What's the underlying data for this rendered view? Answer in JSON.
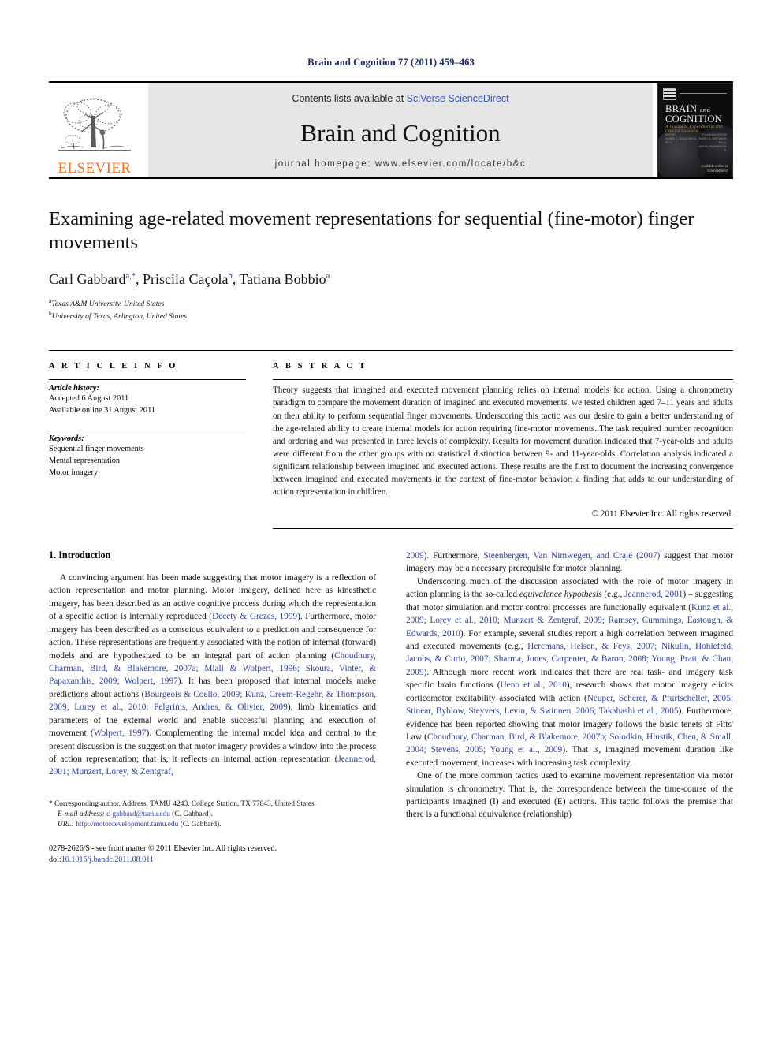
{
  "running_head": "Brain and Cognition 77 (2011) 459–463",
  "masthead": {
    "publisher": "ELSEVIER",
    "contents_prefix": "Contents lists available at ",
    "contents_link": "SciVerse ScienceDirect",
    "journal_title": "Brain and Cognition",
    "homepage": "journal homepage: www.elsevier.com/locate/b&c",
    "cover": {
      "line1": "BRAIN",
      "line1_small": "and",
      "line2": "COGNITION",
      "subtitle": "A Journal of Experimental and Clinical Research",
      "col_left": "EDITOR\nSIDNEY J. SEGALOWITZ, PH. D.",
      "col_right": "FOUNDING EDITOR\nHARRY A. WHITAKER, PH. D.\nMICHEL PARADIS, PH. D.",
      "logo_text": "Available online at\nScienceDirect"
    }
  },
  "article": {
    "title": "Examining age-related movement representations for sequential (fine-motor) finger movements",
    "authors": [
      {
        "name": "Carl Gabbard",
        "sup": "a,*"
      },
      {
        "name": "Priscila Caçola",
        "sup": "b"
      },
      {
        "name": "Tatiana Bobbio",
        "sup": "a"
      }
    ],
    "affiliations": [
      {
        "sup": "a",
        "text": "Texas A&M University, United States"
      },
      {
        "sup": "b",
        "text": "University of Texas, Arlington, United States"
      }
    ]
  },
  "article_info": {
    "heading": "A R T I C L E   I N F O",
    "history_label": "Article history:",
    "history": [
      "Accepted 6 August 2011",
      "Available online 31 August 2011"
    ],
    "keywords_label": "Keywords:",
    "keywords": [
      "Sequential finger movements",
      "Mental representation",
      "Motor imagery"
    ]
  },
  "abstract": {
    "heading": "A B S T R A C T",
    "text": "Theory suggests that imagined and executed movement planning relies on internal models for action. Using a chronometry paradigm to compare the movement duration of imagined and executed movements, we tested children aged 7–11 years and adults on their ability to perform sequential finger movements. Underscoring this tactic was our desire to gain a better understanding of the age-related ability to create internal models for action requiring fine-motor movements. The task required number recognition and ordering and was presented in three levels of complexity. Results for movement duration indicated that 7-year-olds and adults were different from the other groups with no statistical distinction between 9- and 11-year-olds. Correlation analysis indicated a significant relationship between imagined and executed actions. These results are the first to document the increasing convergence between imagined and executed movements in the context of fine-motor behavior; a finding that adds to our understanding of action representation in children.",
    "copyright": "© 2011 Elsevier Inc. All rights reserved."
  },
  "body": {
    "section_title": "1. Introduction",
    "left_paragraph_1_a": "A convincing argument has been made suggesting that motor imagery is a reflection of action representation and motor planning. Motor imagery, defined here as kinesthetic imagery, has been described as an active cognitive process during which the representation of a specific action is internally reproduced (",
    "left_cite_1": "Decety & Grezes, 1999",
    "left_paragraph_1_b": "). Furthermore, motor imagery has been described as a conscious equivalent to a prediction and consequence for action. These representations are frequently associated with the notion of internal (forward) models and are hypothesized to be an integral part of action planning (",
    "left_cite_2": "Choudhury, Charman, Bird, & Blakemore, 2007a; Miall & Wolpert, 1996; Skoura, Vinter, & Papaxanthis, 2009; Wolpert, 1997",
    "left_paragraph_1_c": "). It has been proposed that internal models make predictions about actions (",
    "left_cite_3": "Bourgeois & Coello, 2009; Kunz, Creem-Regehr, & Thompson, 2009; Lorey et al., 2010; Pelgrims, Andres, & Olivier, 2009",
    "left_paragraph_1_d": "), limb kinematics and parameters of the external world and enable successful planning and execution of movement (",
    "left_cite_4": "Wolpert, 1997",
    "left_paragraph_1_e": "). Complementing the internal model idea and central to the present discussion is the suggestion that motor imagery provides a window into the process of action representation; that is, it reflects an internal action representation (",
    "left_cite_5": "Jeannerod, 2001; Munzert, Lorey, & Zentgraf,",
    "right_cite_0": "2009",
    "right_paragraph_1_a": "). Furthermore, ",
    "right_cite_1": "Steenbergen, Van Nimwegen, and Crajé (2007)",
    "right_paragraph_1_b": " suggest that motor imagery may be a necessary prerequisite for motor planning.",
    "right_paragraph_2_a": "Underscoring much of the discussion associated with the role of motor imagery in action planning is the so-called ",
    "right_italic_1": "equivalence hypothesis",
    "right_paragraph_2_b": " (e.g., ",
    "right_cite_2": "Jeannerod, 2001",
    "right_paragraph_2_c": ") – suggesting that motor simulation and motor control processes are functionally equivalent (",
    "right_cite_3": "Kunz et al., 2009; Lorey et al., 2010; Munzert & Zentgraf, 2009; Ramsey, Cummings, Eastough, & Edwards, 2010",
    "right_paragraph_2_d": "). For example, several studies report a high correlation between imagined and executed movements (e.g., ",
    "right_cite_4": "Heremans, Helsen, & Feys, 2007; Nikulin, Hohlefeld, Jacobs, & Curio, 2007; Sharma, Jones, Carpenter, & Baron, 2008; Young, Pratt, & Chau, 2009",
    "right_paragraph_2_e": "). Although more recent work indicates that there are real task- and imagery task specific brain functions (",
    "right_cite_5": "Ueno et al., 2010",
    "right_paragraph_2_f": "), research shows that motor imagery elicits corticomotor excitability associated with action (",
    "right_cite_6": "Neuper, Scherer, & Pfurtscheller, 2005; Stinear, Byblow, Steyvers, Levin, & Swinnen, 2006; Takahashi et al., 2005",
    "right_paragraph_2_g": "). Furthermore, evidence has been reported showing that motor imagery follows the basic tenets of Fitts' Law (",
    "right_cite_7": "Choudhury, Charman, Bird, & Blakemore, 2007b; Solodkin, Hlustik, Chen, & Small, 2004; Stevens, 2005; Young et al., 2009",
    "right_paragraph_2_h": "). That is, imagined movement duration like executed movement, increases with increasing task complexity.",
    "right_paragraph_3": "One of the more common tactics used to examine movement representation via motor simulation is chronometry. That is, the correspondence between the time-course of the participant's imagined (I) and executed (E) actions. This tactic follows the premise that there is a functional equivalence (relationship)"
  },
  "footnotes": {
    "corresponding": "* Corresponding author. Address: TAMU 4243, College Station, TX 77843, United States.",
    "email_label": "E-mail address:",
    "email_value": "c-gabbard@tamu.edu",
    "email_suffix": " (C. Gabbard).",
    "url_label": "URL:",
    "url_value": "http://motordevelopment.tamu.edu",
    "url_suffix": " (C. Gabbard).",
    "imprint_line1": "0278-2626/$ - see front matter © 2011 Elsevier Inc. All rights reserved.",
    "imprint_doi_label": "doi:",
    "imprint_doi_value": "10.1016/j.bandc.2011.08.011"
  },
  "colors": {
    "running_head": "#1d2a63",
    "citation_blue": "#2b3f9e",
    "elsevier_orange": "#F37021",
    "banner_gray": "#e6e6e6"
  }
}
